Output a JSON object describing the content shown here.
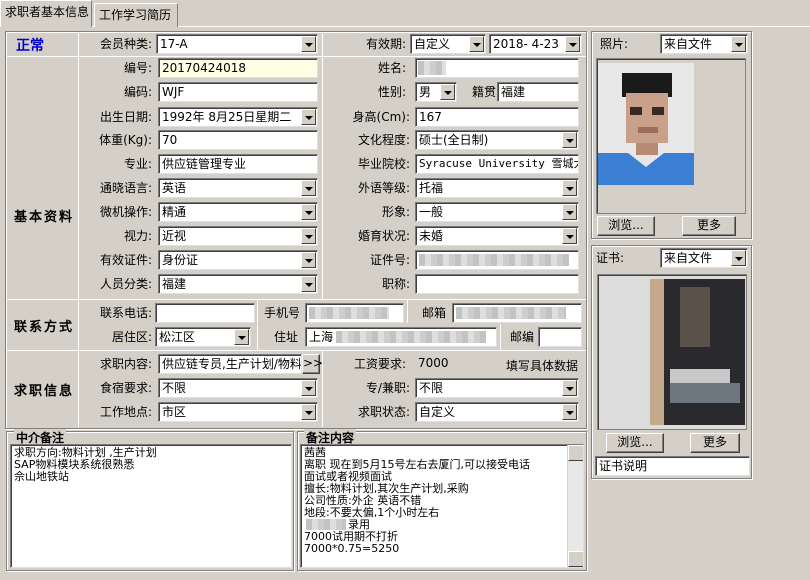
{
  "tabs": [
    "求职者基本信息",
    "工作学习简历"
  ],
  "status": "正常",
  "sections": {
    "basic": "基本资料",
    "contact": "联系方式",
    "job": "求职信息",
    "agent_notes": "中介备注",
    "notes": "备注内容"
  },
  "labels": {
    "member_type": "会员种类:",
    "validity": "有效期:",
    "number": "编号:",
    "name": "姓名:",
    "code": "编码:",
    "gender": "性别:",
    "native": "籍贯",
    "birth": "出生日期:",
    "height": "身高(Cm):",
    "weight": "体重(Kg):",
    "education": "文化程度:",
    "major": "专业:",
    "school": "毕业院校:",
    "language": "通晓语言:",
    "lang_level": "外语等级:",
    "computer": "微机操作:",
    "image": "形象:",
    "vision": "视力:",
    "marital": "婚育状况:",
    "id_type": "有效证件:",
    "id_no": "证件号:",
    "category": "人员分类:",
    "title": "职称:",
    "phone": "联系电话:",
    "mobile": "手机号",
    "email": "邮箱",
    "district": "居住区:",
    "address": "住址",
    "postcode": "邮编",
    "job_content": "求职内容:",
    "salary": "工资要求:",
    "board": "食宿要求:",
    "fulltime": "专/兼职:",
    "location": "工作地点:",
    "job_status": "求职状态:"
  },
  "values": {
    "member_type": "17-A",
    "validity_type": "自定义",
    "validity_date": "2018- 4-23",
    "number": "20170424018",
    "code": "WJF",
    "gender": "男",
    "native": "福建",
    "birth": "1992年 8月25日星期二",
    "height": "167",
    "weight": "70",
    "education": "硕士(全日制)",
    "major": "供应链管理专业",
    "school": "Syracuse University 雪城大学",
    "language": "英语",
    "lang_level": "托福",
    "computer": "精通",
    "image": "一般",
    "vision": "近视",
    "marital": "未婚",
    "id_type": "身份证",
    "category": "福建",
    "title": "",
    "district": "松江区",
    "address_prefix": "上海",
    "job_content": "供应链专员,生产计划/物料",
    "salary": "7000",
    "salary_hint": "填写具体数据",
    "board": "不限",
    "fulltime": "不限",
    "location": "市区",
    "job_status": "自定义"
  },
  "photo": {
    "label": "照片:",
    "source": "来自文件",
    "browse": "浏览...",
    "more": "更多"
  },
  "cert": {
    "label": "证书:",
    "source": "来自文件",
    "browse": "浏览...",
    "more": "更多",
    "desc": "证书说明"
  },
  "agent_notes": [
    "求职方向:物料计划 ,生产计划",
    "SAP物料模块系统很熟悉",
    "佘山地铁站"
  ],
  "notes": [
    "茜茜",
    " 离职 现在到5月15号左右去厦门,可以接受电话",
    "面试或者视频面试",
    "  擅长:物料计划,其次生产计划,采购",
    "  公司性质:外企 英语不错",
    "  地段:不要太偏,1个小时左右",
    "录用",
    "7000试用期不打折",
    "7000*0.75=5250"
  ],
  "colors": {
    "status": "#0000cc",
    "number_bg": "#ffffe6"
  }
}
